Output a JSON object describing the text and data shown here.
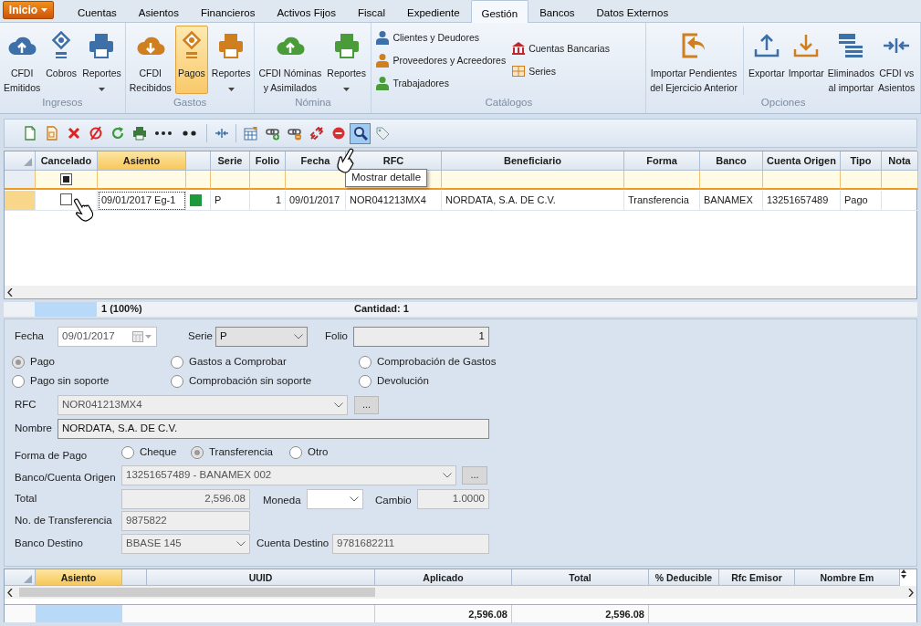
{
  "app_menu": {
    "label": "Inicio"
  },
  "ribbon_tabs": [
    {
      "label": "Cuentas",
      "selected": false
    },
    {
      "label": "Asientos",
      "selected": false
    },
    {
      "label": "Financieros",
      "selected": false
    },
    {
      "label": "Activos Fijos",
      "selected": false
    },
    {
      "label": "Fiscal",
      "selected": false
    },
    {
      "label": "Expediente",
      "selected": false
    },
    {
      "label": "Gestión",
      "selected": true
    },
    {
      "label": "Bancos",
      "selected": false
    },
    {
      "label": "Datos Externos",
      "selected": false
    }
  ],
  "ribbon_groups": [
    {
      "label": "Ingresos",
      "items": [
        {
          "kind": "large",
          "lines": [
            "CFDI",
            "Emitidos"
          ],
          "selected": false,
          "dropdown": false
        },
        {
          "kind": "large",
          "lines": [
            "Cobros"
          ],
          "selected": false,
          "dropdown": false
        },
        {
          "kind": "large",
          "lines": [
            "Reportes"
          ],
          "selected": false,
          "dropdown": true
        }
      ]
    },
    {
      "label": "Gastos",
      "items": [
        {
          "kind": "large",
          "lines": [
            "CFDI",
            "Recibidos"
          ],
          "selected": false,
          "dropdown": false
        },
        {
          "kind": "large",
          "lines": [
            "Pagos"
          ],
          "selected": true,
          "dropdown": false
        },
        {
          "kind": "large",
          "lines": [
            "Reportes"
          ],
          "selected": false,
          "dropdown": true
        }
      ]
    },
    {
      "label": "Nómina",
      "items": [
        {
          "kind": "large",
          "lines": [
            "CFDI Nóminas",
            "y Asimilados"
          ],
          "selected": false,
          "dropdown": false
        },
        {
          "kind": "large",
          "lines": [
            "Reportes"
          ],
          "selected": false,
          "dropdown": true
        }
      ]
    },
    {
      "label": "Catálogos",
      "items": [
        {
          "kind": "small",
          "lines": [
            "Clientes y Deudores"
          ]
        },
        {
          "kind": "small",
          "lines": [
            "Proveedores y Acreedores"
          ]
        },
        {
          "kind": "small",
          "lines": [
            "Trabajadores"
          ]
        },
        {
          "kind": "small",
          "lines": [
            "Cuentas Bancarias"
          ]
        },
        {
          "kind": "small",
          "lines": [
            "Series"
          ]
        }
      ]
    },
    {
      "label": "Opciones",
      "items": [
        {
          "kind": "large",
          "lines": [
            "Importar Pendientes",
            "del Ejercicio Anterior"
          ],
          "selected": false,
          "dropdown": false
        },
        {
          "kind": "large",
          "lines": [
            "Exportar"
          ],
          "selected": false,
          "dropdown": false
        },
        {
          "kind": "large",
          "lines": [
            "Importar"
          ],
          "selected": false,
          "dropdown": false
        },
        {
          "kind": "large",
          "lines": [
            "Eliminados",
            "al importar"
          ],
          "selected": false,
          "dropdown": false
        },
        {
          "kind": "large",
          "lines": [
            "CFDI vs",
            "Asientos"
          ],
          "selected": false,
          "dropdown": false
        }
      ]
    }
  ],
  "toolbar": [
    {
      "selected": false
    },
    {
      "selected": false
    },
    {
      "selected": false
    },
    {
      "selected": false
    },
    {
      "selected": false
    },
    {
      "selected": false
    },
    {
      "selected": false
    },
    {
      "selected": false
    },
    {
      "selected": false
    },
    {
      "selected": false
    },
    {
      "selected": false
    },
    {
      "selected": false
    },
    {
      "selected": false
    },
    {
      "selected": false
    },
    {
      "selected": true
    },
    {
      "selected": false
    }
  ],
  "tooltip": "Mostrar detalle",
  "grid": {
    "columns": [
      {
        "highlighted": false
      },
      {
        "label": "Cancelado",
        "highlighted": false
      },
      {
        "label": "Asiento",
        "highlighted": true
      },
      {
        "highlighted": false
      },
      {
        "label": "Serie",
        "highlighted": false
      },
      {
        "label": "Folio",
        "highlighted": false
      },
      {
        "label": "Fecha",
        "highlighted": false
      },
      {
        "label": "RFC",
        "highlighted": false
      },
      {
        "label": "Beneficiario",
        "highlighted": false
      },
      {
        "label": "Forma",
        "highlighted": false
      },
      {
        "label": "Banco",
        "highlighted": false
      },
      {
        "label": "Cuenta Origen",
        "highlighted": false
      },
      {
        "label": "Tipo",
        "highlighted": false
      },
      {
        "label": "Nota",
        "highlighted": false
      }
    ],
    "filter_row": {
      "cancelled_indeterminate": true
    },
    "rows": [
      {
        "selected": true,
        "cancelled": false,
        "asiento": "09/01/2017 Eg-1",
        "color": "#1c9a3c",
        "serie": "P",
        "folio": "1",
        "fecha": "09/01/2017",
        "rfc": "NOR041213MX4",
        "beneficiario": "NORDATA, S.A. DE C.V.",
        "forma": "Transferencia",
        "banco": "BANAMEX",
        "cuenta_origen": "13251657489",
        "tipo": "Pago"
      }
    ],
    "footer": {
      "count_percent": "1 (100%)",
      "cantidad": "Cantidad: 1"
    }
  },
  "form": {
    "fecha": {
      "label": "Fecha",
      "value": "09/01/2017"
    },
    "serie": {
      "label": "Serie",
      "value": "P"
    },
    "folio": {
      "label": "Folio",
      "value": "1"
    },
    "tipo_options": [
      {
        "label": "Pago",
        "selected": true
      },
      {
        "label": "Gastos a Comprobar",
        "selected": false
      },
      {
        "label": "Comprobación de Gastos",
        "selected": false
      },
      {
        "label": "Pago sin soporte",
        "selected": false
      },
      {
        "label": "Comprobación sin soporte",
        "selected": false
      },
      {
        "label": "Devolución",
        "selected": false
      }
    ],
    "rfc": {
      "label": "RFC",
      "value": "NOR041213MX4",
      "button": "..."
    },
    "nombre": {
      "label": "Nombre",
      "value": "NORDATA, S.A. DE C.V."
    },
    "forma_de_pago": {
      "label": "Forma de Pago",
      "options": [
        {
          "label": "Cheque",
          "selected": false
        },
        {
          "label": "Transferencia",
          "selected": true
        },
        {
          "label": "Otro",
          "selected": false
        }
      ]
    },
    "banco_cuenta_origen": {
      "label": "Banco/Cuenta Origen",
      "value": "13251657489 - BANAMEX  002",
      "button": "..."
    },
    "total": {
      "label": "Total",
      "value": "2,596.08"
    },
    "moneda": {
      "label": "Moneda"
    },
    "cambio": {
      "label": "Cambio",
      "value": "1.0000"
    },
    "no_transferencia": {
      "label": "No. de Transferencia",
      "value": "9875822"
    },
    "banco_destino": {
      "label": "Banco Destino",
      "value": "BBASE  145"
    },
    "cuenta_destino": {
      "label": "Cuenta Destino",
      "value": "9781682211"
    }
  },
  "bottom_grid": {
    "columns": [
      {
        "highlighted": false
      },
      {
        "label": "Asiento",
        "highlighted": true
      },
      {
        "highlighted": false
      },
      {
        "label": "UUID",
        "highlighted": false
      },
      {
        "label": "Aplicado",
        "highlighted": false
      },
      {
        "label": "Total",
        "highlighted": false
      },
      {
        "label": "% Deducible",
        "highlighted": false
      },
      {
        "label": "Rfc Emisor",
        "highlighted": false
      },
      {
        "label": "Nombre Em",
        "highlighted": false
      }
    ],
    "totals": {
      "aplicado": "2,596.08",
      "total": "2,596.08"
    }
  }
}
